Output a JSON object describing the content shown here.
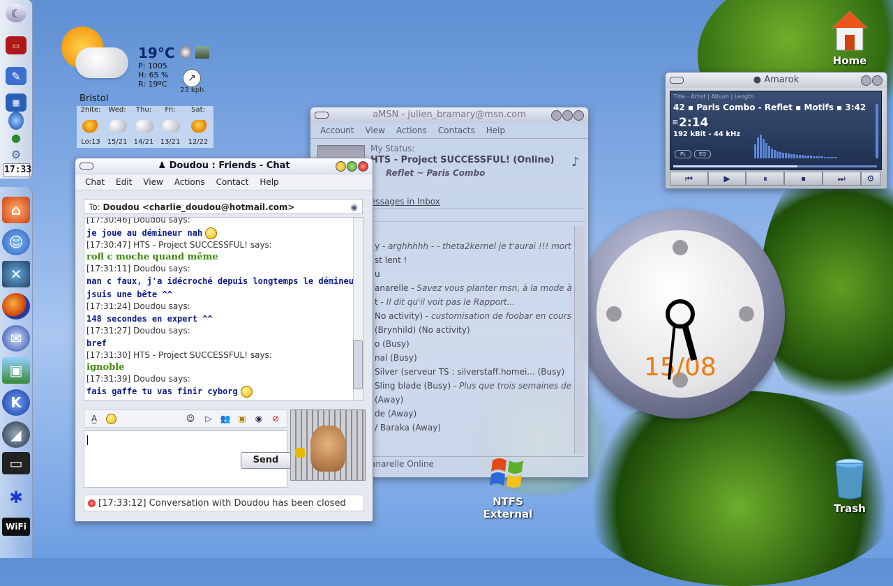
{
  "panel": {
    "clock": "17:33"
  },
  "weather": {
    "temperature": "19°C",
    "pressure": "P: 1005",
    "humidity": "H: 65 %",
    "realfeel": "R: 19ºC",
    "wind_speed": "23 kph",
    "city": "Bristol",
    "forecast": [
      {
        "day": "2nite:",
        "lo": "Lo:13"
      },
      {
        "day": "Wed:",
        "lo": "15/21"
      },
      {
        "day": "Thu:",
        "lo": "14/21"
      },
      {
        "day": "Fri:",
        "lo": "13/21"
      },
      {
        "day": "Sat:",
        "lo": "12/22"
      }
    ]
  },
  "amsn": {
    "title": "aMSN - julien_bramary@msn.com",
    "menu": [
      "Account",
      "View",
      "Actions",
      "Contacts",
      "Help"
    ],
    "my_status_label": "My Status:",
    "nick": "HTS - Project SUCCESSFUL! (Online)",
    "psm": "Reflet ~ Paris Combo",
    "inbox": "essages in Inbox",
    "contacts": [
      {
        "text": ")",
        "italic": ""
      },
      {
        "text": "y  - ",
        "italic": "arghhhhh - - theta2kernel je t'aurai !!!  mort o"
      },
      {
        "text": "st lent !",
        "italic": ""
      },
      {
        "text": "u",
        "italic": ""
      },
      {
        "text": "anarelle  - ",
        "italic": "Savez vous planter msn, à la mode à la"
      },
      {
        "text": "t  - ",
        "italic": "Il dit qu'il voit pas le Rapport..."
      },
      {
        "text": "No activity) - ",
        "italic": "customisation de foobar en cours"
      },
      {
        "text": "(Brynhild)  (No activity)",
        "italic": ""
      },
      {
        "text": "o  (Busy)",
        "italic": ""
      },
      {
        "text": "nal  (Busy)",
        "italic": ""
      },
      {
        "text": "Silver (serveur TS : silverstaff.homei...  (Busy)",
        "italic": ""
      },
      {
        "text": "Sling blade  (Busy) - ",
        "italic": "Plus que trois semaines de"
      },
      {
        "text": "(Away)",
        "italic": ""
      },
      {
        "text": "de  (Away)",
        "italic": ""
      },
      {
        "text": "/ Baraka  (Away)",
        "italic": ""
      }
    ],
    "footer": "anarelle Online"
  },
  "chat": {
    "title": "Doudou : Friends - Chat",
    "menu": [
      "Chat",
      "Edit",
      "View",
      "Actions",
      "Contact",
      "Help"
    ],
    "to_label": "To:",
    "to_value": "Doudou <charlie_doudou@hotmail.com>",
    "messages": [
      {
        "kind": "h",
        "text": "[17:30:46] Doudou says:"
      },
      {
        "kind": "d",
        "text": "je joue au démineur nah",
        "smiley": true
      },
      {
        "kind": "h",
        "text": "[17:30:47] HTS - Project SUCCESSFUL! says:"
      },
      {
        "kind": "g",
        "text": "rofl c moche quand même"
      },
      {
        "kind": "h",
        "text": "[17:31:11] Doudou says:"
      },
      {
        "kind": "d",
        "text": "nan c faux, j'a idécroché depuis longtemps le démineur,"
      },
      {
        "kind": "d",
        "text": "jsuis une bête ^^"
      },
      {
        "kind": "h",
        "text": "[17:31:24] Doudou says:"
      },
      {
        "kind": "d",
        "text": "148 secondes en expert ^^"
      },
      {
        "kind": "h",
        "text": "[17:31:27] Doudou says:"
      },
      {
        "kind": "d",
        "text": "bref"
      },
      {
        "kind": "h",
        "text": "[17:31:30] HTS - Project SUCCESSFUL! says:"
      },
      {
        "kind": "g",
        "text": "ignoble"
      },
      {
        "kind": "h",
        "text": "[17:31:39] Doudou says:"
      },
      {
        "kind": "d",
        "text": "fais gaffe tu vas finir cyborg",
        "smiley": true
      }
    ],
    "send_label": "Send",
    "closed_notice": "[17:33:12] Conversation with Doudou has been closed"
  },
  "amarok": {
    "title": "Amarok",
    "header": "Title - Artist | Album | Length",
    "track_info": "42  ▪  Paris Combo - Reflet  ▪  Motifs  ▪  3:42",
    "time": "2:14",
    "rate": "192 kBit - 44 kHz",
    "pl_label": "PL",
    "eq_label": "EQ",
    "progress": 0.61
  },
  "clock": {
    "date": "15/08"
  },
  "desktop_icons": {
    "home": "Home",
    "ntfs_line1": "NTFS",
    "ntfs_line2": "External",
    "trash": "Trash"
  },
  "colors": {
    "accent": "#0b1a8a",
    "green_msg": "#3e8a0a",
    "clock_date": "#ee7a10"
  }
}
